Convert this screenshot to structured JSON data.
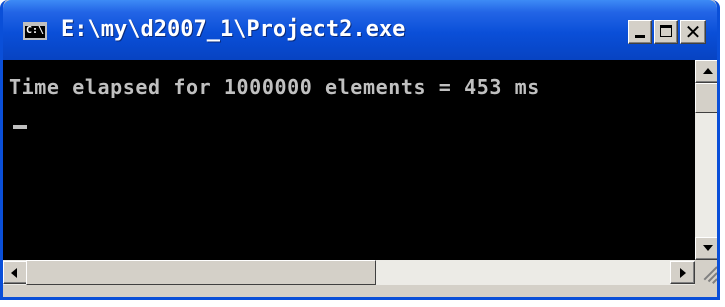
{
  "window": {
    "title": "E:\\my\\d2007_1\\Project2.exe",
    "app_icon": {
      "name": "console-icon",
      "text": "C:\\"
    },
    "controls": {
      "minimize_icon": "minimize-icon",
      "maximize_icon": "maximize-icon",
      "close_icon": "close-icon",
      "close_glyph": "✕"
    }
  },
  "console": {
    "output_line": "Time elapsed for 1000000 elements = 453 ms",
    "background": "#000000",
    "foreground": "#c0c0c0"
  },
  "colors": {
    "titlebar": "#0a4fd8",
    "frame": "#d4d0c8"
  }
}
